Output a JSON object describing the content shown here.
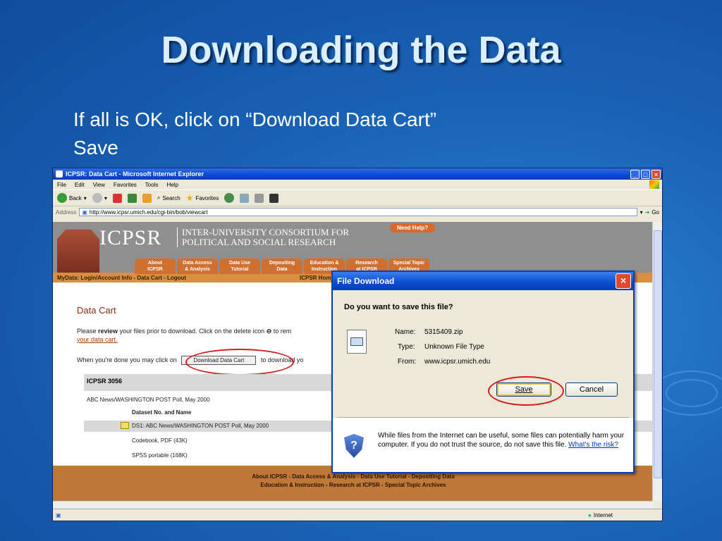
{
  "slide": {
    "title": "Downloading the Data",
    "bullets": [
      "If all is OK, click on “Download Data Cart”",
      "Save"
    ]
  },
  "browser": {
    "window_title": "ICPSR: Data Cart - Microsoft Internet Explorer",
    "menu": [
      "File",
      "Edit",
      "View",
      "Favorites",
      "Tools",
      "Help"
    ],
    "toolbar": {
      "back": "Back",
      "search": "Search",
      "favorites": "Favorites"
    },
    "address_label": "Address",
    "address": "http://www.icpsr.umich.edu/cgi-bin/bob/viewcart",
    "go": "Go",
    "status_zone": "Internet"
  },
  "page": {
    "logo": "ICPSR",
    "consortium_line1": "INTER-UNIVERSITY CONSORTIUM FOR",
    "consortium_line2": "POLITICAL AND SOCIAL RESEARCH",
    "need_help": "Need Help?",
    "nav": [
      {
        "l1": "About",
        "l2": "ICPSR"
      },
      {
        "l1": "Data Access",
        "l2": "& Analysis"
      },
      {
        "l1": "Data Use",
        "l2": "Tutorial"
      },
      {
        "l1": "Depositing",
        "l2": "Data"
      },
      {
        "l1": "Education &",
        "l2": "Instruction"
      },
      {
        "l1": "Research",
        "l2": "at ICPSR"
      },
      {
        "l1": "Special Topic",
        "l2": "Archives"
      }
    ],
    "mydata": "MyData: Login/Account Info - Data Cart - Logout",
    "home": "ICPSR Hom",
    "cart_title": "Data Cart",
    "review_pre": "Please ",
    "review_bold": "review",
    "review_post": " your files prior to download. Click on the delete icon",
    "review_tail": " to rem",
    "your_cart_link": "your data cart.",
    "done_pre": "When you're done you may click on",
    "download_button": "Download Data Cart",
    "done_post": "to download yo",
    "study_id": "ICPSR 3056",
    "study_name": "ABC News/WASHINGTON POST Poll, May 2000",
    "dataset_header": "Dataset No. and Name",
    "dataset": "DS1: ABC News/WASHINGTON POST Poll, May 2000",
    "file1": "Codebook, PDF (43K)",
    "file2": "SPSS portable (168K)",
    "footer1": "About ICPSR - Data Access & Analysis - Data Use Tutorial - Depositing Data",
    "footer2": "Education & Instruction - Research at ICPSR - Special Topic Archives"
  },
  "dialog": {
    "title": "File Download",
    "question": "Do you want to save this file?",
    "name_label": "Name:",
    "name": "5315409.zip",
    "type_label": "Type:",
    "type": "Unknown File Type",
    "from_label": "From:",
    "from": "www.icpsr.umich.edu",
    "save": "Save",
    "cancel": "Cancel",
    "warning": "While files from the Internet can be useful, some files can potentially harm your computer. If you do not trust the source, do not save this file.",
    "risk_link": "What's the risk?"
  }
}
